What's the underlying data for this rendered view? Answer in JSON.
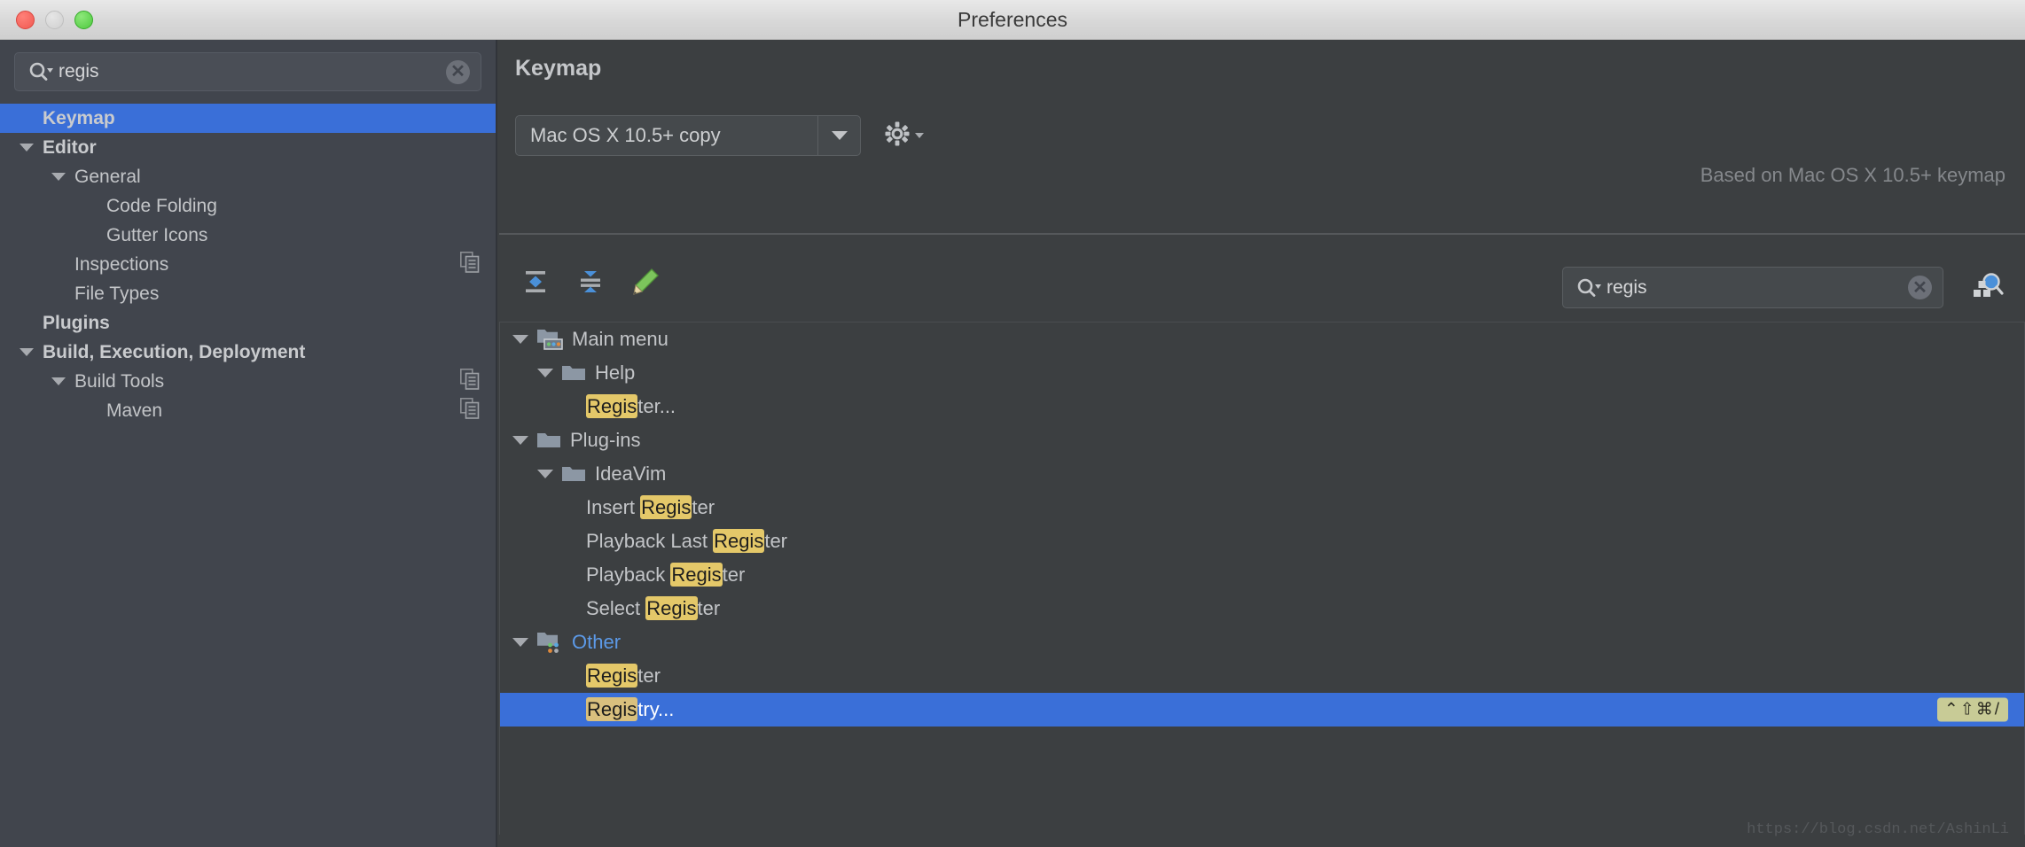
{
  "window": {
    "title": "Preferences",
    "traffic_lights": [
      "close-button",
      "minimize-button",
      "zoom-button"
    ]
  },
  "sidebar": {
    "search": {
      "value": "regis",
      "placeholder": "",
      "icon": "search-icon",
      "clear_icon": "clear-icon"
    },
    "items": [
      {
        "label": "Keymap",
        "indent": 0,
        "arrow": "none",
        "bold": true,
        "selected": true,
        "copy_icon": false
      },
      {
        "label": "Editor",
        "indent": 0,
        "arrow": "expanded",
        "bold": true,
        "selected": false,
        "copy_icon": false
      },
      {
        "label": "General",
        "indent": 1,
        "arrow": "expanded",
        "bold": false,
        "selected": false,
        "copy_icon": false
      },
      {
        "label": "Code Folding",
        "indent": 2,
        "arrow": "none",
        "bold": false,
        "selected": false,
        "copy_icon": false
      },
      {
        "label": "Gutter Icons",
        "indent": 2,
        "arrow": "none",
        "bold": false,
        "selected": false,
        "copy_icon": false
      },
      {
        "label": "Inspections",
        "indent": 1,
        "arrow": "none",
        "bold": false,
        "selected": false,
        "copy_icon": true
      },
      {
        "label": "File Types",
        "indent": 1,
        "arrow": "none",
        "bold": false,
        "selected": false,
        "copy_icon": false
      },
      {
        "label": "Plugins",
        "indent": 0,
        "arrow": "none",
        "bold": true,
        "selected": false,
        "copy_icon": false
      },
      {
        "label": "Build, Execution, Deployment",
        "indent": 0,
        "arrow": "expanded",
        "bold": true,
        "selected": false,
        "copy_icon": false
      },
      {
        "label": "Build Tools",
        "indent": 1,
        "arrow": "expanded",
        "bold": false,
        "selected": false,
        "copy_icon": true
      },
      {
        "label": "Maven",
        "indent": 2,
        "arrow": "none",
        "bold": false,
        "selected": false,
        "copy_icon": true
      }
    ]
  },
  "main": {
    "page_title": "Keymap",
    "keymap_combo": {
      "value": "Mac OS X 10.5+ copy",
      "caret_icon": "chevron-down-icon"
    },
    "gear": {
      "icon": "gear-icon",
      "caret_icon": "chevron-down-icon"
    },
    "based_on": "Based on Mac OS X 10.5+ keymap",
    "toolbar": [
      {
        "name": "expand-all-button",
        "icon": "expand-all-icon"
      },
      {
        "name": "collapse-all-button",
        "icon": "collapse-all-icon"
      },
      {
        "name": "edit-shortcut-button",
        "icon": "pencil-icon"
      }
    ],
    "search": {
      "value": "regis",
      "placeholder": "",
      "icon": "search-icon",
      "clear_icon": "clear-icon"
    },
    "find_by_shortcut": {
      "icon": "find-by-shortcut-icon"
    },
    "tree": [
      {
        "label": "Main menu",
        "prefix": "",
        "highlight": "",
        "suffix": "",
        "plain": "Main menu",
        "indent": 0,
        "arrow": "expanded",
        "icon": "main-menu-folder-icon",
        "selected": false,
        "blue": false,
        "shortcut": ""
      },
      {
        "label": "Help",
        "plain": "Help",
        "prefix": "",
        "highlight": "",
        "suffix": "",
        "indent": 1,
        "arrow": "expanded",
        "icon": "folder-icon",
        "selected": false,
        "blue": false,
        "shortcut": ""
      },
      {
        "label": "Register...",
        "plain": "",
        "prefix": "",
        "highlight": "Regis",
        "suffix": "ter...",
        "indent": 2,
        "arrow": "none",
        "icon": "none",
        "selected": false,
        "blue": false,
        "shortcut": ""
      },
      {
        "label": "Plug-ins",
        "plain": "Plug-ins",
        "prefix": "",
        "highlight": "",
        "suffix": "",
        "indent": 0,
        "arrow": "expanded",
        "icon": "folder-icon",
        "selected": false,
        "blue": false,
        "shortcut": ""
      },
      {
        "label": "IdeaVim",
        "plain": "IdeaVim",
        "prefix": "",
        "highlight": "",
        "suffix": "",
        "indent": 1,
        "arrow": "expanded",
        "icon": "folder-icon",
        "selected": false,
        "blue": false,
        "shortcut": ""
      },
      {
        "label": "Insert Register",
        "plain": "",
        "prefix": "Insert ",
        "highlight": "Regis",
        "suffix": "ter",
        "indent": 2,
        "arrow": "none",
        "icon": "none",
        "selected": false,
        "blue": false,
        "shortcut": ""
      },
      {
        "label": "Playback Last Register",
        "plain": "",
        "prefix": "Playback Last ",
        "highlight": "Regis",
        "suffix": "ter",
        "indent": 2,
        "arrow": "none",
        "icon": "none",
        "selected": false,
        "blue": false,
        "shortcut": ""
      },
      {
        "label": "Playback Register",
        "plain": "",
        "prefix": "Playback ",
        "highlight": "Regis",
        "suffix": "ter",
        "indent": 2,
        "arrow": "none",
        "icon": "none",
        "selected": false,
        "blue": false,
        "shortcut": ""
      },
      {
        "label": "Select Register",
        "plain": "",
        "prefix": "Select ",
        "highlight": "Regis",
        "suffix": "ter",
        "indent": 2,
        "arrow": "none",
        "icon": "none",
        "selected": false,
        "blue": false,
        "shortcut": ""
      },
      {
        "label": "Other",
        "plain": "Other",
        "prefix": "",
        "highlight": "",
        "suffix": "",
        "indent": 0,
        "arrow": "expanded",
        "icon": "other-folder-icon",
        "selected": false,
        "blue": true,
        "shortcut": ""
      },
      {
        "label": "Register",
        "plain": "",
        "prefix": "",
        "highlight": "Regis",
        "suffix": "ter",
        "indent": 2,
        "arrow": "none",
        "icon": "none",
        "selected": false,
        "blue": false,
        "shortcut": ""
      },
      {
        "label": "Registry...",
        "plain": "",
        "prefix": "",
        "highlight": "Regis",
        "suffix": "try...",
        "indent": 2,
        "arrow": "none",
        "icon": "none",
        "selected": true,
        "blue": false,
        "shortcut": "⌃⇧⌘/"
      }
    ]
  },
  "watermark": "https://blog.csdn.net/AshinLi",
  "colors": {
    "selection_blue": "#3a6fd8",
    "highlight_yellow": "#e4c869",
    "sidebar_bg": "#41454d",
    "main_bg": "#3c3f41",
    "link_blue": "#5c9ae8",
    "shortcut_badge": "#c8cb96"
  }
}
